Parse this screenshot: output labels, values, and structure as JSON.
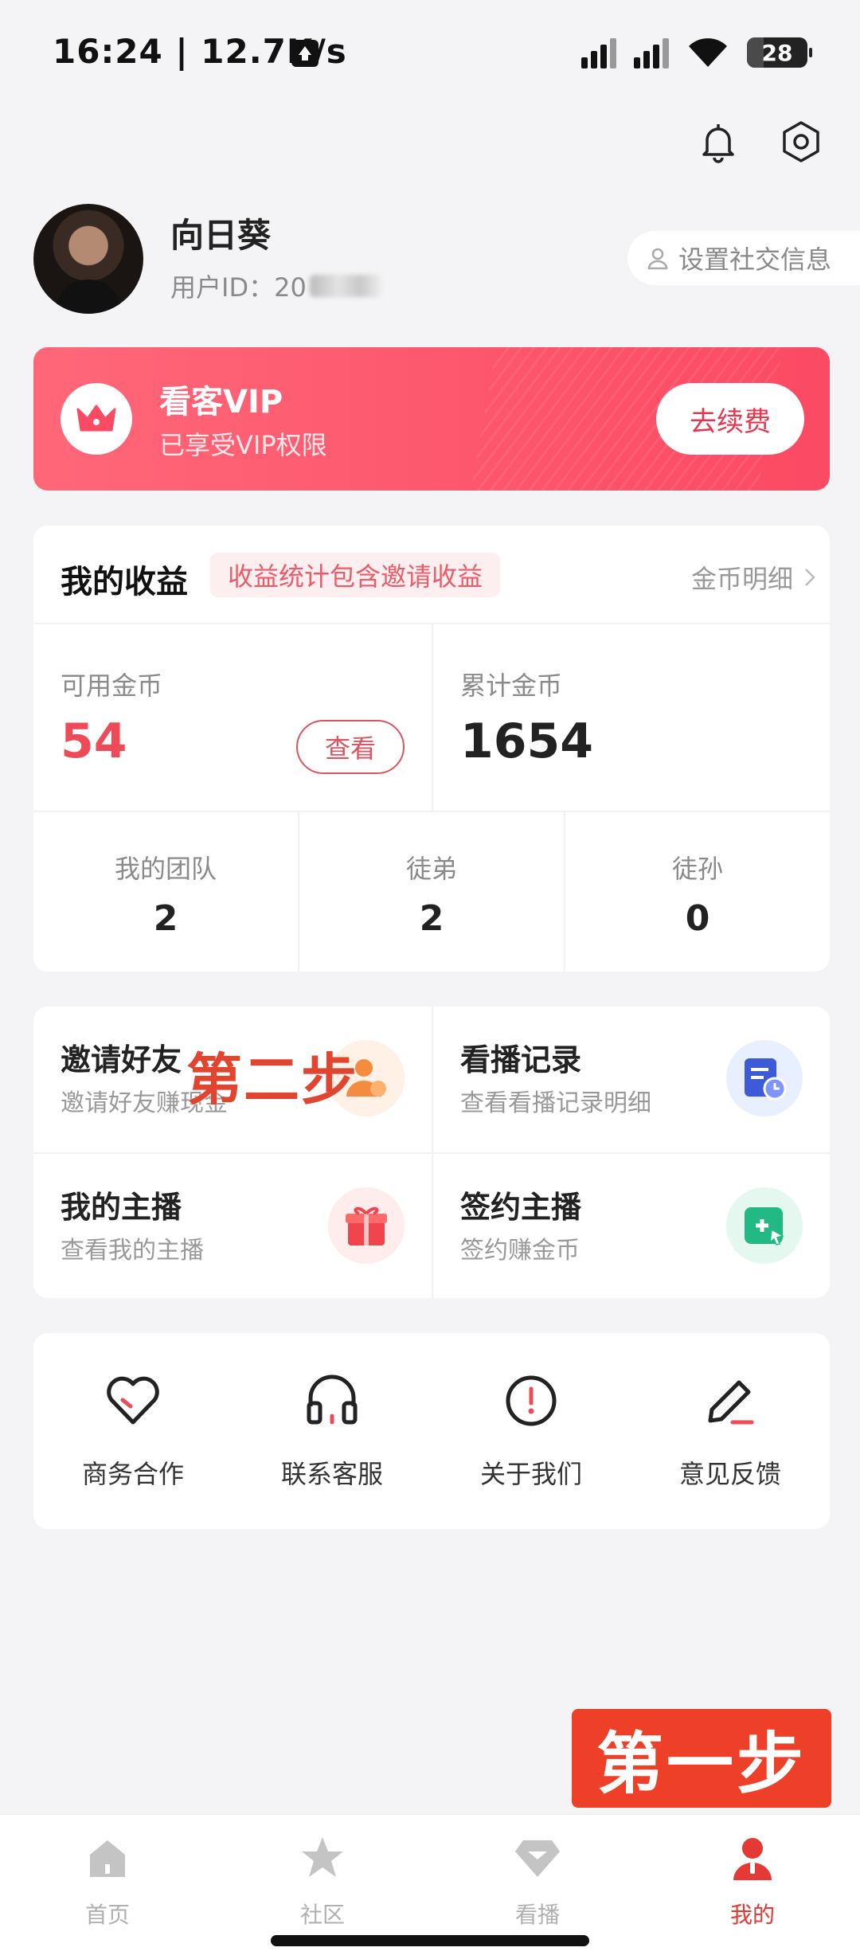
{
  "status_bar": {
    "time": "16:24 | 12.7K/s",
    "battery": "28"
  },
  "profile": {
    "name": "向日葵",
    "id_label": "用户ID：20",
    "social_button": "设置社交信息"
  },
  "vip": {
    "title": "看客VIP",
    "subtitle": "已享受VIP权限",
    "renew_button": "去续费"
  },
  "earnings": {
    "title": "我的收益",
    "tag": "收益统计包含邀请收益",
    "detail_link": "金币明细",
    "available_label": "可用金币",
    "available_value": "54",
    "view_button": "查看",
    "total_label": "累计金币",
    "total_value": "1654",
    "team": [
      {
        "label": "我的团队",
        "value": "2"
      },
      {
        "label": "徒弟",
        "value": "2"
      },
      {
        "label": "徒孙",
        "value": "0"
      }
    ]
  },
  "functions": [
    {
      "title": "邀请好友",
      "subtitle": "邀请好友赚现金"
    },
    {
      "title": "看播记录",
      "subtitle": "查看看播记录明细"
    },
    {
      "title": "我的主播",
      "subtitle": "查看我的主播"
    },
    {
      "title": "签约主播",
      "subtitle": "签约赚金币"
    }
  ],
  "services": [
    {
      "label": "商务合作",
      "icon": "heart-icon"
    },
    {
      "label": "联系客服",
      "icon": "headset-icon"
    },
    {
      "label": "关于我们",
      "icon": "info-icon"
    },
    {
      "label": "意见反馈",
      "icon": "pen-icon"
    }
  ],
  "annotations": {
    "step1": "第一步",
    "step2": "第二步"
  },
  "tabs": [
    {
      "label": "首页",
      "icon": "home-icon"
    },
    {
      "label": "社区",
      "icon": "star-icon"
    },
    {
      "label": "看播",
      "icon": "diamond-icon"
    },
    {
      "label": "我的",
      "icon": "person-icon",
      "active": true
    }
  ],
  "colors": {
    "accent": "#ee4b59",
    "vip_start": "#ff6779",
    "vip_end": "#fb4a63",
    "step_label": "#ee4028"
  }
}
